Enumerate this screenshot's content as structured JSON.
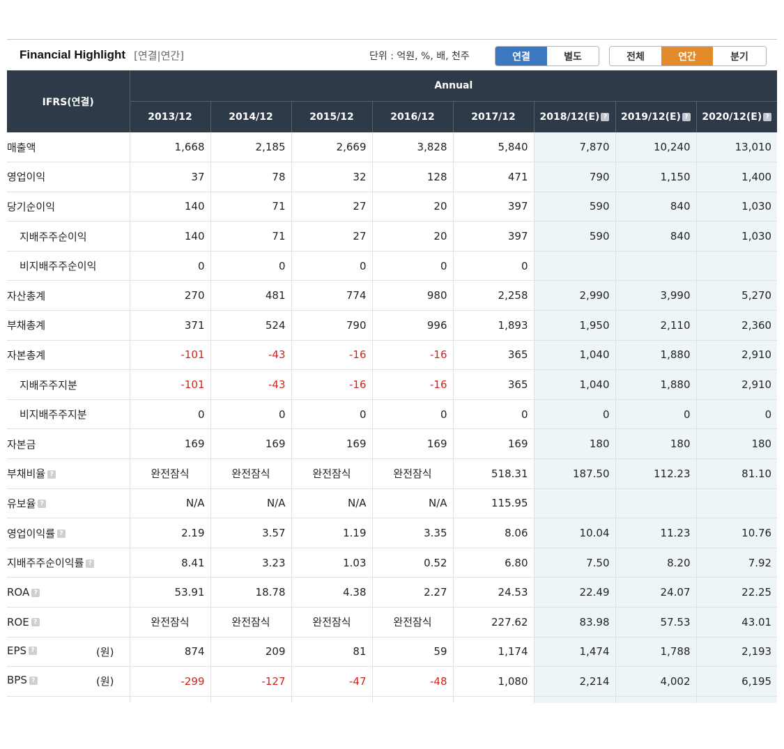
{
  "header": {
    "title": "Financial Highlight",
    "subtitle": "[연결|연간]",
    "unit": "단위 : 억원, %, 배, 천주",
    "toggle_consolidated": "연결",
    "toggle_separate": "별도",
    "toggle_all": "전체",
    "toggle_annual": "연간",
    "toggle_quarter": "분기"
  },
  "table": {
    "corner": "IFRS(연결)",
    "group": "Annual",
    "help_glyph": "?",
    "columns": [
      "2013/12",
      "2014/12",
      "2015/12",
      "2016/12",
      "2017/12",
      "2018/12(E)",
      "2019/12(E)",
      "2020/12(E)"
    ],
    "rows": [
      {
        "label": "매출액",
        "indent": false,
        "values": [
          "1,668",
          "2,185",
          "2,669",
          "3,828",
          "5,840",
          "7,870",
          "10,240",
          "13,010"
        ]
      },
      {
        "label": "영업이익",
        "indent": false,
        "values": [
          "37",
          "78",
          "32",
          "128",
          "471",
          "790",
          "1,150",
          "1,400"
        ]
      },
      {
        "label": "당기순이익",
        "indent": false,
        "values": [
          "140",
          "71",
          "27",
          "20",
          "397",
          "590",
          "840",
          "1,030"
        ]
      },
      {
        "label": "지배주주순이익",
        "indent": true,
        "values": [
          "140",
          "71",
          "27",
          "20",
          "397",
          "590",
          "840",
          "1,030"
        ]
      },
      {
        "label": "비지배주주순이익",
        "indent": true,
        "values": [
          "0",
          "0",
          "0",
          "0",
          "0",
          "",
          "",
          ""
        ]
      },
      {
        "label": "자산총계",
        "indent": false,
        "values": [
          "270",
          "481",
          "774",
          "980",
          "2,258",
          "2,990",
          "3,990",
          "5,270"
        ]
      },
      {
        "label": "부채총계",
        "indent": false,
        "values": [
          "371",
          "524",
          "790",
          "996",
          "1,893",
          "1,950",
          "2,110",
          "2,360"
        ]
      },
      {
        "label": "자본총계",
        "indent": false,
        "values": [
          "-101",
          "-43",
          "-16",
          "-16",
          "365",
          "1,040",
          "1,880",
          "2,910"
        ]
      },
      {
        "label": "지배주주지분",
        "indent": true,
        "values": [
          "-101",
          "-43",
          "-16",
          "-16",
          "365",
          "1,040",
          "1,880",
          "2,910"
        ]
      },
      {
        "label": "비지배주주지분",
        "indent": true,
        "values": [
          "0",
          "0",
          "0",
          "0",
          "0",
          "0",
          "0",
          "0"
        ]
      },
      {
        "label": "자본금",
        "indent": false,
        "values": [
          "169",
          "169",
          "169",
          "169",
          "169",
          "180",
          "180",
          "180"
        ]
      },
      {
        "label": "부채비율",
        "indent": false,
        "help": true,
        "values": [
          "완전잠식",
          "완전잠식",
          "완전잠식",
          "완전잠식",
          "518.31",
          "187.50",
          "112.23",
          "81.10"
        ]
      },
      {
        "label": "유보율",
        "indent": false,
        "help": true,
        "values": [
          "N/A",
          "N/A",
          "N/A",
          "N/A",
          "115.95",
          "",
          "",
          ""
        ]
      },
      {
        "label": "영업이익률",
        "indent": false,
        "help": true,
        "values": [
          "2.19",
          "3.57",
          "1.19",
          "3.35",
          "8.06",
          "10.04",
          "11.23",
          "10.76"
        ]
      },
      {
        "label": "지배주주순이익률",
        "indent": false,
        "help": true,
        "values": [
          "8.41",
          "3.23",
          "1.03",
          "0.52",
          "6.80",
          "7.50",
          "8.20",
          "7.92"
        ]
      },
      {
        "label": "ROA",
        "indent": false,
        "help": true,
        "values": [
          "53.91",
          "18.78",
          "4.38",
          "2.27",
          "24.53",
          "22.49",
          "24.07",
          "22.25"
        ]
      },
      {
        "label": "ROE",
        "indent": false,
        "help": true,
        "values": [
          "완전잠식",
          "완전잠식",
          "완전잠식",
          "완전잠식",
          "227.62",
          "83.98",
          "57.53",
          "43.01"
        ]
      },
      {
        "label": "EPS",
        "indent": false,
        "help": true,
        "unit": "(원)",
        "values": [
          "874",
          "209",
          "81",
          "59",
          "1,174",
          "1,474",
          "1,788",
          "2,193"
        ]
      },
      {
        "label": "BPS",
        "indent": false,
        "help": true,
        "unit": "(원)",
        "values": [
          "-299",
          "-127",
          "-47",
          "-48",
          "1,080",
          "2,214",
          "4,002",
          "6,195"
        ]
      }
    ]
  }
}
